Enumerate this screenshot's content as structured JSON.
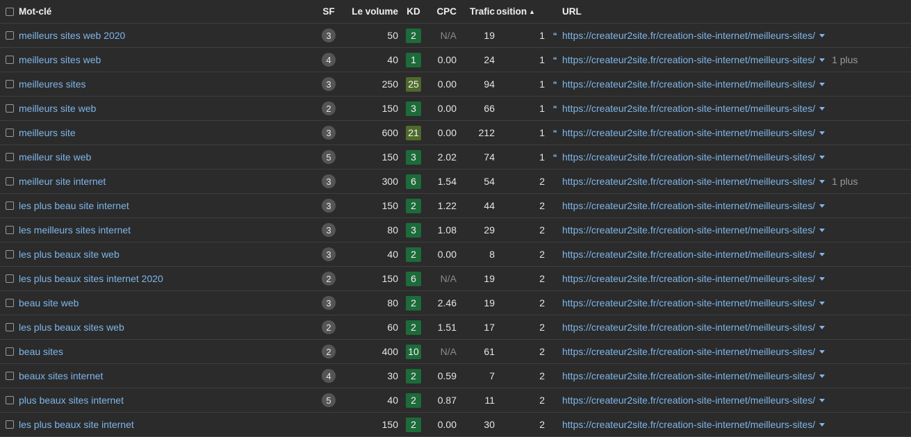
{
  "colors": {
    "background": "#2b2b2b",
    "link": "#7fb6ea",
    "kd_low": "#1d6b3a",
    "kd_mid": "#4f6a2c",
    "sf_badge": "#555555"
  },
  "header": {
    "keyword": "Mot-clé",
    "sf": "SF",
    "volume": "Le volume",
    "kd": "KD",
    "cpc": "CPC",
    "traffic": "Trafic",
    "position": "Position",
    "position_sort_icon": "sort-ascending-icon",
    "url": "URL"
  },
  "rows": [
    {
      "keyword": "meilleurs sites web 2020",
      "sf": "3",
      "volume": "50",
      "kd": "2",
      "kd_level": "low",
      "cpc": "N/A",
      "traffic": "19",
      "position": "1",
      "snippet": true,
      "url": "https://createur2site.fr/creation-site-internet/meilleurs-sites/",
      "more": ""
    },
    {
      "keyword": "meilleurs sites web",
      "sf": "4",
      "volume": "40",
      "kd": "1",
      "kd_level": "low",
      "cpc": "0.00",
      "traffic": "24",
      "position": "1",
      "snippet": true,
      "url": "https://createur2site.fr/creation-site-internet/meilleurs-sites/",
      "more": "1 plus"
    },
    {
      "keyword": "meilleures sites",
      "sf": "3",
      "volume": "250",
      "kd": "25",
      "kd_level": "mid",
      "cpc": "0.00",
      "traffic": "94",
      "position": "1",
      "snippet": true,
      "url": "https://createur2site.fr/creation-site-internet/meilleurs-sites/",
      "more": ""
    },
    {
      "keyword": "meilleurs site web",
      "sf": "2",
      "volume": "150",
      "kd": "3",
      "kd_level": "low",
      "cpc": "0.00",
      "traffic": "66",
      "position": "1",
      "snippet": true,
      "url": "https://createur2site.fr/creation-site-internet/meilleurs-sites/",
      "more": ""
    },
    {
      "keyword": "meilleurs site",
      "sf": "3",
      "volume": "600",
      "kd": "21",
      "kd_level": "mid",
      "cpc": "0.00",
      "traffic": "212",
      "position": "1",
      "snippet": true,
      "url": "https://createur2site.fr/creation-site-internet/meilleurs-sites/",
      "more": ""
    },
    {
      "keyword": "meilleur site web",
      "sf": "5",
      "volume": "150",
      "kd": "3",
      "kd_level": "low",
      "cpc": "2.02",
      "traffic": "74",
      "position": "1",
      "snippet": true,
      "url": "https://createur2site.fr/creation-site-internet/meilleurs-sites/",
      "more": ""
    },
    {
      "keyword": "meilleur site internet",
      "sf": "3",
      "volume": "300",
      "kd": "6",
      "kd_level": "low",
      "cpc": "1.54",
      "traffic": "54",
      "position": "2",
      "snippet": false,
      "url": "https://createur2site.fr/creation-site-internet/meilleurs-sites/",
      "more": "1 plus"
    },
    {
      "keyword": "les plus beau site internet",
      "sf": "3",
      "volume": "150",
      "kd": "2",
      "kd_level": "low",
      "cpc": "1.22",
      "traffic": "44",
      "position": "2",
      "snippet": false,
      "url": "https://createur2site.fr/creation-site-internet/meilleurs-sites/",
      "more": ""
    },
    {
      "keyword": "les meilleurs sites internet",
      "sf": "3",
      "volume": "80",
      "kd": "3",
      "kd_level": "low",
      "cpc": "1.08",
      "traffic": "29",
      "position": "2",
      "snippet": false,
      "url": "https://createur2site.fr/creation-site-internet/meilleurs-sites/",
      "more": ""
    },
    {
      "keyword": "les plus beaux site web",
      "sf": "3",
      "volume": "40",
      "kd": "2",
      "kd_level": "low",
      "cpc": "0.00",
      "traffic": "8",
      "position": "2",
      "snippet": false,
      "url": "https://createur2site.fr/creation-site-internet/meilleurs-sites/",
      "more": ""
    },
    {
      "keyword": "les plus beaux sites internet 2020",
      "sf": "2",
      "volume": "150",
      "kd": "6",
      "kd_level": "low",
      "cpc": "N/A",
      "traffic": "19",
      "position": "2",
      "snippet": false,
      "url": "https://createur2site.fr/creation-site-internet/meilleurs-sites/",
      "more": ""
    },
    {
      "keyword": "beau site web",
      "sf": "3",
      "volume": "80",
      "kd": "2",
      "kd_level": "low",
      "cpc": "2.46",
      "traffic": "19",
      "position": "2",
      "snippet": false,
      "url": "https://createur2site.fr/creation-site-internet/meilleurs-sites/",
      "more": ""
    },
    {
      "keyword": "les plus beaux sites web",
      "sf": "2",
      "volume": "60",
      "kd": "2",
      "kd_level": "low",
      "cpc": "1.51",
      "traffic": "17",
      "position": "2",
      "snippet": false,
      "url": "https://createur2site.fr/creation-site-internet/meilleurs-sites/",
      "more": ""
    },
    {
      "keyword": "beau sites",
      "sf": "2",
      "volume": "400",
      "kd": "10",
      "kd_level": "low",
      "cpc": "N/A",
      "traffic": "61",
      "position": "2",
      "snippet": false,
      "url": "https://createur2site.fr/creation-site-internet/meilleurs-sites/",
      "more": ""
    },
    {
      "keyword": "beaux sites internet",
      "sf": "4",
      "volume": "30",
      "kd": "2",
      "kd_level": "low",
      "cpc": "0.59",
      "traffic": "7",
      "position": "2",
      "snippet": false,
      "url": "https://createur2site.fr/creation-site-internet/meilleurs-sites/",
      "more": ""
    },
    {
      "keyword": "plus beaux sites internet",
      "sf": "5",
      "volume": "40",
      "kd": "2",
      "kd_level": "low",
      "cpc": "0.87",
      "traffic": "11",
      "position": "2",
      "snippet": false,
      "url": "https://createur2site.fr/creation-site-internet/meilleurs-sites/",
      "more": ""
    },
    {
      "keyword": "les plus beaux site internet",
      "sf": "",
      "volume": "150",
      "kd": "2",
      "kd_level": "low",
      "cpc": "0.00",
      "traffic": "30",
      "position": "2",
      "snippet": false,
      "url": "https://createur2site.fr/creation-site-internet/meilleurs-sites/",
      "more": ""
    }
  ]
}
